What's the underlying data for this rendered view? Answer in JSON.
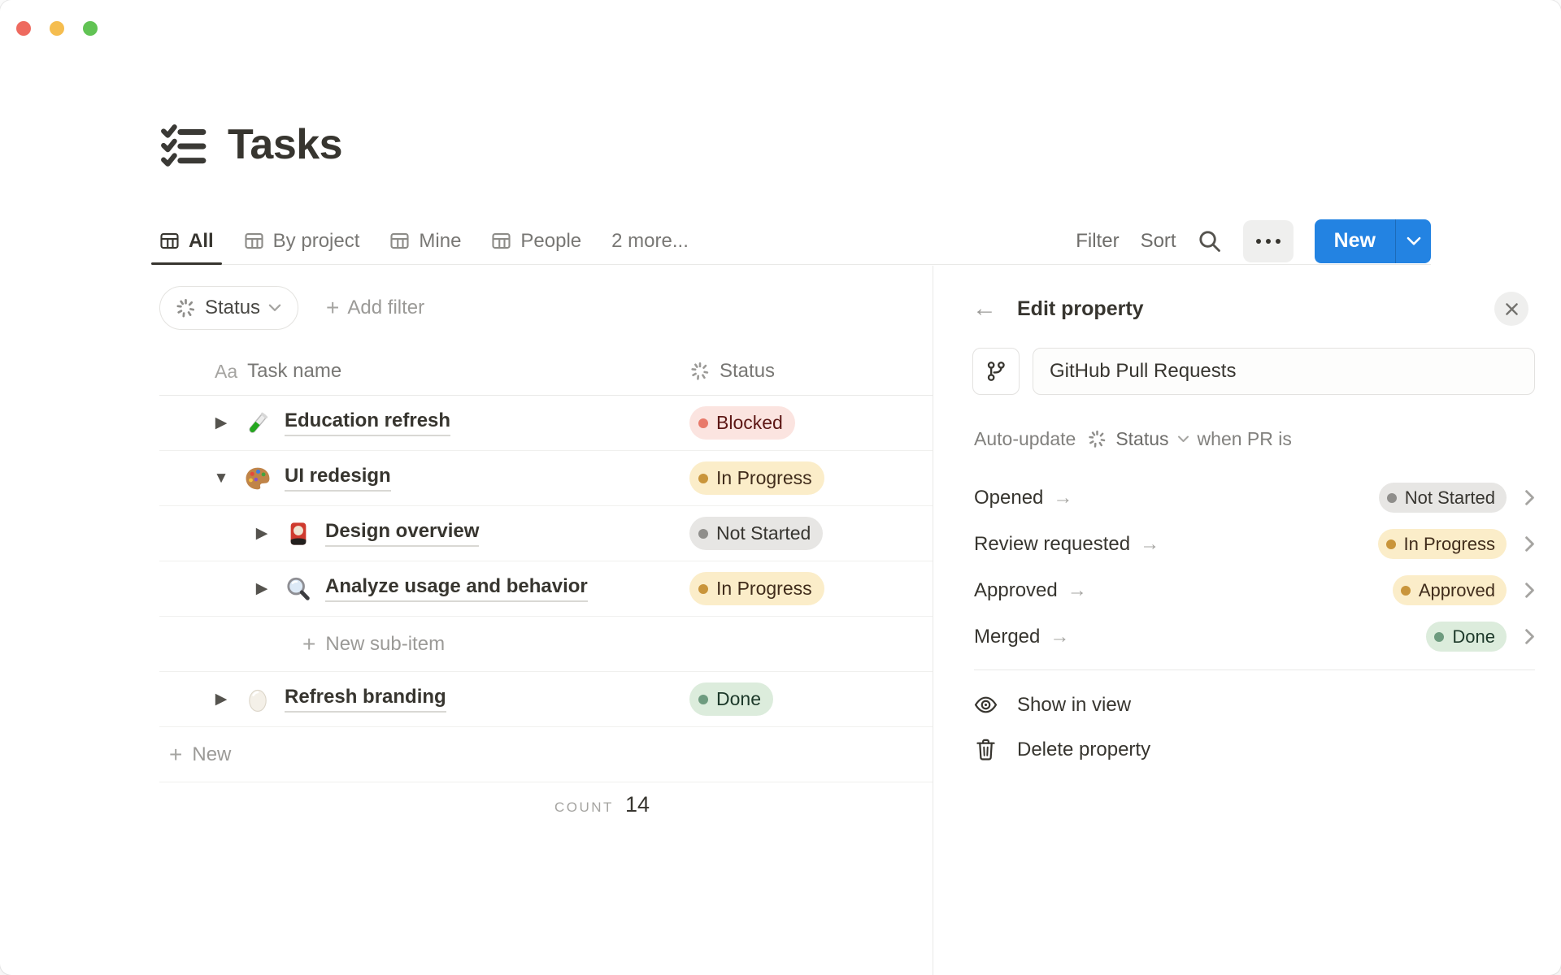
{
  "window": {
    "title": "Tasks",
    "title_icon": "checklist-icon"
  },
  "tabs": {
    "items": [
      {
        "label": "All",
        "icon": "table-icon",
        "active": true
      },
      {
        "label": "By project",
        "icon": "table-icon",
        "active": false
      },
      {
        "label": "Mine",
        "icon": "table-icon",
        "active": false
      },
      {
        "label": "People",
        "icon": "table-icon",
        "active": false
      },
      {
        "label": "2 more...",
        "icon": null,
        "active": false
      }
    ]
  },
  "toolbar": {
    "filter_label": "Filter",
    "sort_label": "Sort",
    "search_icon": "search-icon",
    "more_icon": "ellipsis-icon",
    "new_label": "New"
  },
  "filter_bar": {
    "status_chip_label": "Status",
    "add_filter_label": "Add filter"
  },
  "table": {
    "columns": [
      {
        "icon_label": "Aa",
        "label": "Task name"
      },
      {
        "icon": "status-spinner-icon",
        "label": "Status"
      }
    ],
    "rows": [
      {
        "level": 0,
        "toggle": "collapsed",
        "icon": "test-tube-icon",
        "title": "Education refresh",
        "status": {
          "label": "Blocked",
          "color": "red"
        }
      },
      {
        "level": 0,
        "toggle": "expanded",
        "icon": "palette-icon",
        "title": "UI redesign",
        "status": {
          "label": "In Progress",
          "color": "yellow"
        }
      },
      {
        "level": 1,
        "toggle": "collapsed",
        "icon": "flower-card-icon",
        "title": "Design overview",
        "status": {
          "label": "Not Started",
          "color": "gray"
        }
      },
      {
        "level": 1,
        "toggle": "collapsed",
        "icon": "magnifier-icon",
        "title": "Analyze usage and behavior",
        "status": {
          "label": "In Progress",
          "color": "yellow"
        }
      },
      {
        "level": 0,
        "toggle": "collapsed",
        "icon": "egg-icon",
        "title": "Refresh branding",
        "status": {
          "label": "Done",
          "color": "green"
        }
      }
    ],
    "new_sub_item_label": "New sub-item",
    "new_label": "New",
    "footer": {
      "count_label": "COUNT",
      "count_value": "14"
    }
  },
  "panel": {
    "title": "Edit property",
    "name_field": {
      "icon": "git-branch-icon",
      "value": "GitHub Pull Requests"
    },
    "auto_update": {
      "prefix": "Auto-update",
      "property": "Status",
      "suffix": "when PR is"
    },
    "mappings": [
      {
        "event": "Opened",
        "status": {
          "label": "Not Started",
          "color": "gray"
        }
      },
      {
        "event": "Review requested",
        "status": {
          "label": "In Progress",
          "color": "yellow"
        }
      },
      {
        "event": "Approved",
        "status": {
          "label": "Approved",
          "color": "yellow"
        }
      },
      {
        "event": "Merged",
        "status": {
          "label": "Done",
          "color": "green"
        }
      }
    ],
    "actions": [
      {
        "icon": "eye-icon",
        "label": "Show in view"
      },
      {
        "icon": "trash-icon",
        "label": "Delete property"
      }
    ]
  },
  "colors": {
    "accent_blue": "#2383e2",
    "status": {
      "blocked_bg": "#fbe4e0",
      "blocked_dot": "#e8796a",
      "blocked_text": "#5d1715",
      "in_progress_bg": "#fbedc9",
      "in_progress_dot": "#c9953b",
      "in_progress_text": "#402c1b",
      "not_started_bg": "#e7e6e4",
      "not_started_dot": "#8f8e8b",
      "not_started_text": "#373530",
      "done_bg": "#dcecdc",
      "done_dot": "#6e9b7f",
      "done_text": "#1c3829"
    }
  }
}
